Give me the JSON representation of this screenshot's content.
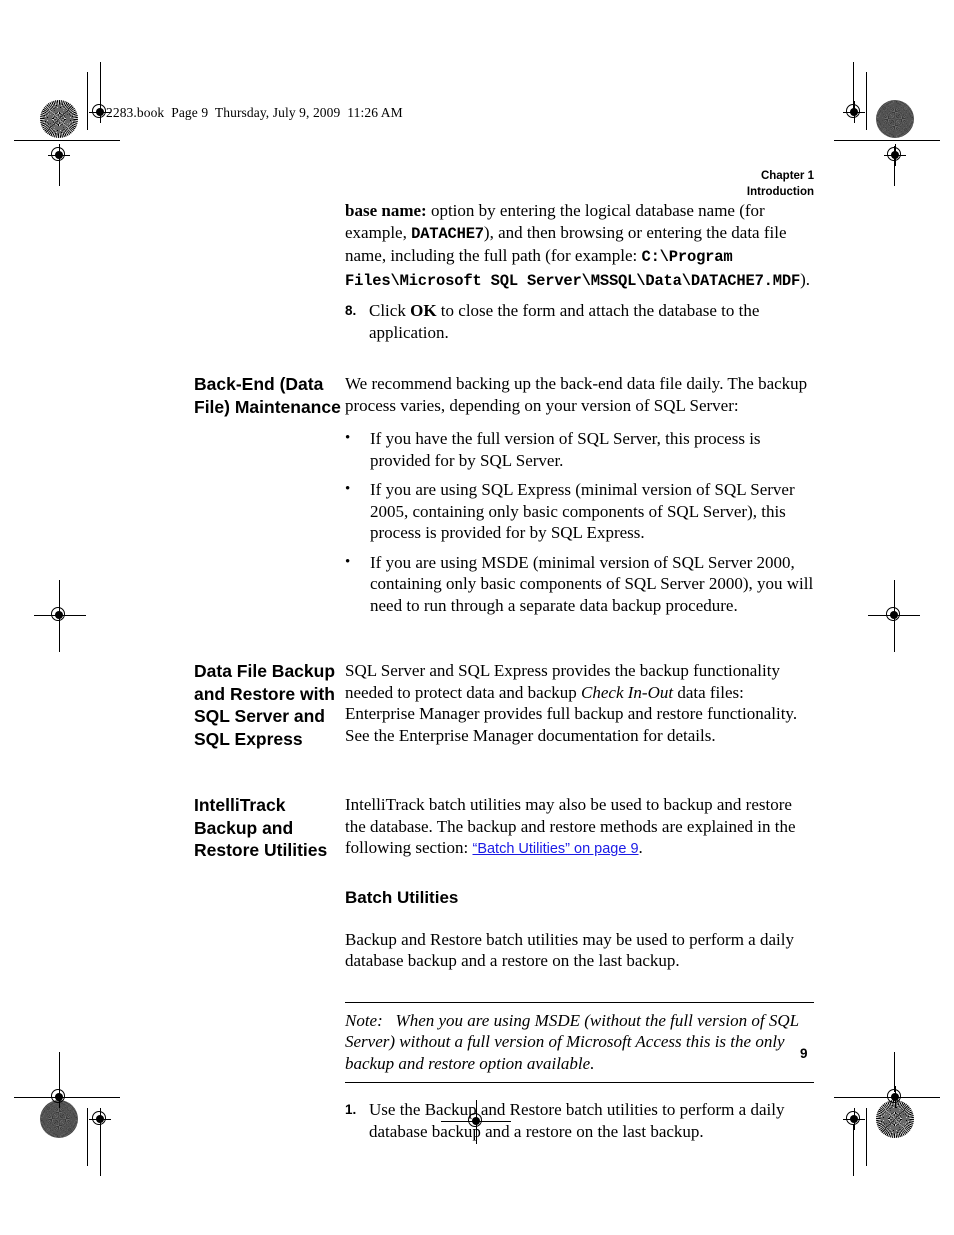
{
  "file_header": "2283.book  Page 9  Thursday, July 9, 2009  11:26 AM",
  "chapter": {
    "line1": "Chapter 1",
    "line2": "Introduction"
  },
  "page_number": "9",
  "link_color": "#1a1ae6",
  "step_8": {
    "marker": "8.",
    "continuation": {
      "lead_bold": "base name:",
      "part1": " option by entering the logical database name (for example, ",
      "code1": "DATACHE7",
      "part2": "), and then browsing or entering the data file name, including the full path (for example: ",
      "code2": "C:\\Program Files\\Microsoft SQL Server\\MSSQL\\Data\\DATACHE7.MDF",
      "part3": ")."
    },
    "text_before_bold": "Click ",
    "bold_word": "OK",
    "text_after_bold": " to close the form and attach the database to the application."
  },
  "section_backend": {
    "heading": "Back-End (Data File) Maintenance",
    "intro": "We recommend backing up the back-end data file daily. The backup process varies, depending on your version of SQL Server:",
    "bullet_marker": "•",
    "bullets": [
      "If you have the full version of SQL Server, this process is provided for by SQL Server.",
      "If you are using SQL Express (minimal version of SQL Server 2005, containing only basic components of SQL Server), this process is provided for by SQL Express.",
      "If you are using MSDE (minimal version of SQL Server 2000, containing only basic components of SQL Server 2000), you will need to run through a separate data backup procedure."
    ]
  },
  "section_datafile": {
    "heading": "Data File Backup and Restore with SQL Server and SQL Express",
    "body_part1": "SQL Server and SQL Express provides the backup functionality needed to protect data and backup ",
    "body_italic": "Check In-Out",
    "body_part2": " data files: Enterprise Manager provides full backup and restore functionality. See the Enterprise Manager documentation for details."
  },
  "section_intellitrack": {
    "heading": "IntelliTrack Backup and Restore Utilities",
    "body_part1": "IntelliTrack batch utilities may also be used to backup and restore the database. The backup and restore methods are explained in the following section: ",
    "link_text": "“Batch Utilities” on page 9",
    "body_part2": ".",
    "subheading": "Batch Utilities",
    "paragraph": "Backup and Restore batch utilities may be used to perform a daily database backup and a restore on the last backup.",
    "note": {
      "label": "Note:",
      "text": "When you are using MSDE (without the full version of SQL Server) without a full version of Microsoft Access this is the only backup and restore option available."
    },
    "step": {
      "marker": "1.",
      "text": "Use the Backup and Restore batch utilities to perform a daily database backup and a restore on the last backup."
    }
  }
}
